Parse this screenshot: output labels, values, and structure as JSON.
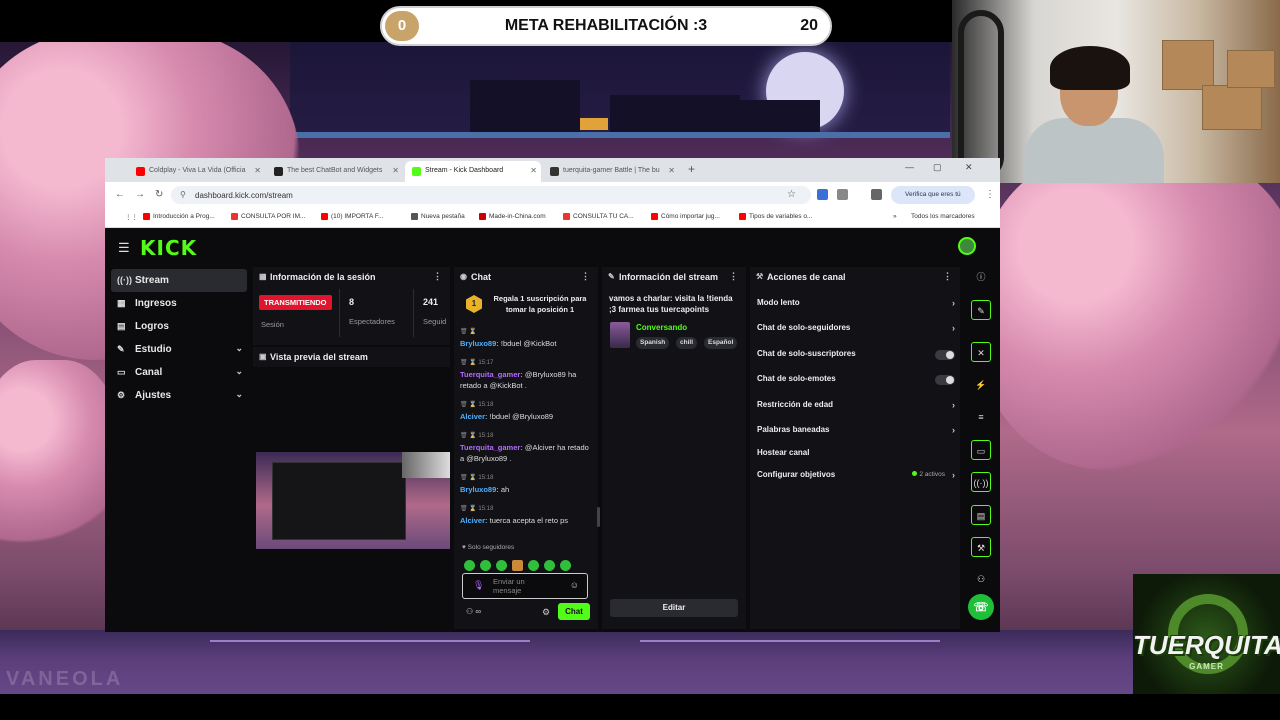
{
  "goal": {
    "current": "0",
    "title": "META REHABILITACIÓN :3",
    "target": "20",
    "progress": 0
  },
  "browser": {
    "tabs": [
      {
        "title": "Coldplay - Viva La Vida (Officia",
        "icon": "youtube-icon",
        "color": "#ff0000"
      },
      {
        "title": "The best ChatBot and Widgets",
        "icon": "botrix-icon",
        "color": "#222222"
      },
      {
        "title": "Stream - Kick Dashboard",
        "icon": "kick-icon",
        "color": "#53fc18"
      },
      {
        "title": "tuerquita-gamer Battle | The bu",
        "icon": "battle-icon",
        "color": "#333333"
      }
    ],
    "new_tab": "+",
    "url": "dashboard.kick.com/stream",
    "verifica": "Verifica que eres tú",
    "bookmarks": [
      {
        "label": "Introducción a Prog...",
        "color": "#ff0000"
      },
      {
        "label": "CONSULTA POR IM...",
        "color": "#e33"
      },
      {
        "label": "(10) IMPORTA F...",
        "color": "#ff0000"
      },
      {
        "label": "Nueva pestaña",
        "color": "#555"
      },
      {
        "label": "Made-in-China.com",
        "color": "#c00"
      },
      {
        "label": "CONSULTA TU CA...",
        "color": "#e33"
      },
      {
        "label": "Cómo importar jug...",
        "color": "#ff0000"
      },
      {
        "label": "Tipos de variables o...",
        "color": "#ff0000"
      }
    ],
    "all_bookmarks": "Todos los marcadores"
  },
  "app": {
    "logo": "KICK",
    "nav": [
      {
        "label": "Stream",
        "icon": "broadcast-icon",
        "glyph": "((·))",
        "active": true,
        "chevron": false
      },
      {
        "label": "Ingresos",
        "icon": "revenue-icon",
        "glyph": "▦",
        "active": false,
        "chevron": false
      },
      {
        "label": "Logros",
        "icon": "achievements-icon",
        "glyph": "▤",
        "active": false,
        "chevron": false
      },
      {
        "label": "Estudio",
        "icon": "studio-icon",
        "glyph": "✎",
        "active": false,
        "chevron": true
      },
      {
        "label": "Canal",
        "icon": "channel-icon",
        "glyph": "▭",
        "active": false,
        "chevron": true
      },
      {
        "label": "Ajustes",
        "icon": "settings-icon",
        "glyph": "⚙",
        "active": false,
        "chevron": true
      }
    ],
    "session": {
      "title": "Información de la sesión",
      "live_badge": "TRANSMITIENDO",
      "session_label": "Sesión",
      "viewers": "8",
      "viewers_label": "Espectadores",
      "followers": "241",
      "followers_label": "Seguid"
    },
    "preview": {
      "title": "Vista previa del stream"
    },
    "chat": {
      "title": "Chat",
      "banner": "Regala 1 suscripción para tomar la posición 1",
      "banner_rank": "1",
      "messages": [
        {
          "time": "",
          "user": "Bryluxo89:",
          "ucolor": "u-blue",
          "text": "!bduel @KickBot"
        },
        {
          "time": "15:17",
          "user": "Tuerquita_gamer:",
          "ucolor": "u-purple",
          "text": "@Bryluxo89 ha retado a @KickBot ."
        },
        {
          "time": "15:18",
          "user": "Alciver:",
          "ucolor": "u-blue",
          "text": "!bduel @Bryluxo89"
        },
        {
          "time": "15:18",
          "user": "Tuerquita_gamer:",
          "ucolor": "u-purple",
          "text": "@Alciver ha retado a @Bryluxo89 ."
        },
        {
          "time": "15:18",
          "user": "Bryluxo89:",
          "ucolor": "u-blue",
          "text": "ah"
        },
        {
          "time": "15:18",
          "user": "Alciver:",
          "ucolor": "u-blue",
          "text": "tuerca acepta el reto ps"
        }
      ],
      "followers_only": "Solo seguidores",
      "input_placeholder": "Enviar un mensaje",
      "send": "Chat"
    },
    "stream_info": {
      "title": "Información del stream",
      "stream_title": "vamos a charlar: visita la !tienda ;3 farmea tus tuercapoints",
      "category": "Conversando",
      "tags": [
        "Spanish",
        "chill",
        "Español"
      ],
      "edit": "Editar"
    },
    "channel_actions": {
      "title": "Acciones de canal",
      "rows": [
        {
          "label": "Modo lento",
          "type": "arrow"
        },
        {
          "label": "Chat de solo-seguidores",
          "type": "arrow"
        },
        {
          "label": "Chat de solo-suscriptores",
          "type": "toggle"
        },
        {
          "label": "Chat de solo-emotes",
          "type": "toggle"
        },
        {
          "label": "Restricción de edad",
          "type": "arrow"
        },
        {
          "label": "Palabras baneadas",
          "type": "arrow"
        },
        {
          "label": "Hostear canal",
          "type": "none"
        },
        {
          "label": "Configurar objetivos",
          "type": "count",
          "count": "2 activos"
        }
      ]
    }
  },
  "logo": {
    "name": "TUERQUITA",
    "sub": "GAMER"
  },
  "watermark": "VANEOLA"
}
